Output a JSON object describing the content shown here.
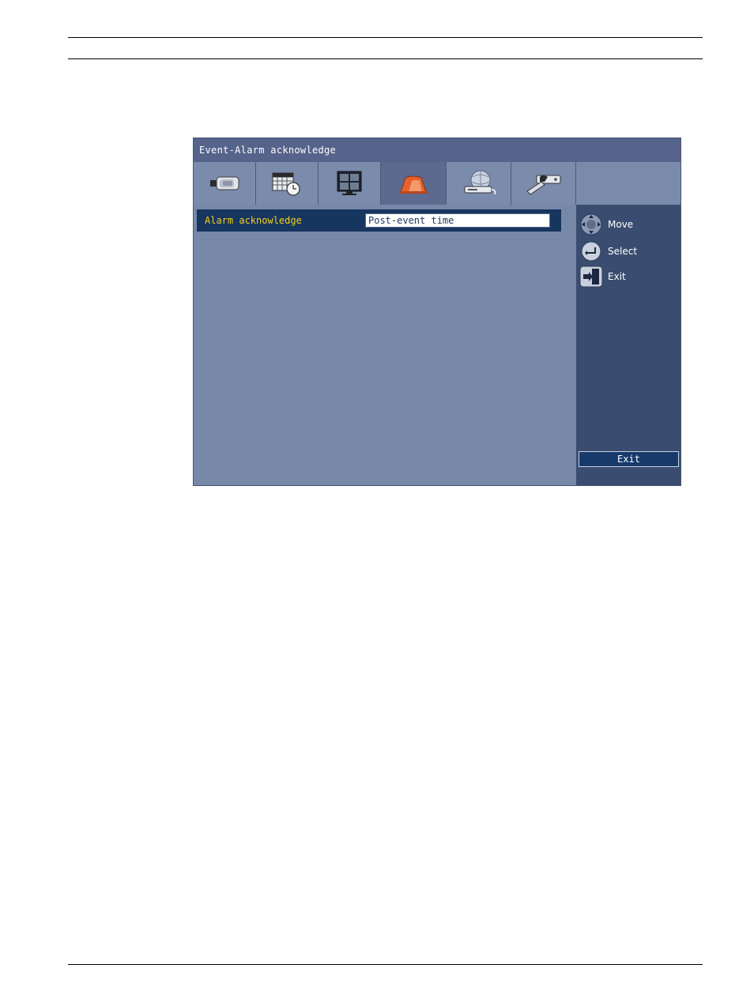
{
  "window": {
    "title": "Event-Alarm acknowledge"
  },
  "tabs": [
    {
      "id": "camera",
      "icon": "camera-icon"
    },
    {
      "id": "schedule",
      "icon": "schedule-clock-icon"
    },
    {
      "id": "monitor",
      "icon": "monitor-icon"
    },
    {
      "id": "event",
      "icon": "alarm-event-icon",
      "active": true
    },
    {
      "id": "network",
      "icon": "network-globe-icon"
    },
    {
      "id": "system",
      "icon": "system-tools-icon"
    }
  ],
  "settings": {
    "rows": [
      {
        "label": "Alarm acknowledge",
        "value": "Post-event time"
      }
    ]
  },
  "hints": {
    "move": "Move",
    "select": "Select",
    "exit": "Exit"
  },
  "buttons": {
    "exit": "Exit"
  },
  "colors": {
    "title_bar": "#56638a",
    "panel": "#7787a8",
    "side_panel": "#3a4d70",
    "selected_row": "#16355f",
    "label_highlight": "#f2d21b",
    "active_tab_icon": "#e8612c"
  }
}
